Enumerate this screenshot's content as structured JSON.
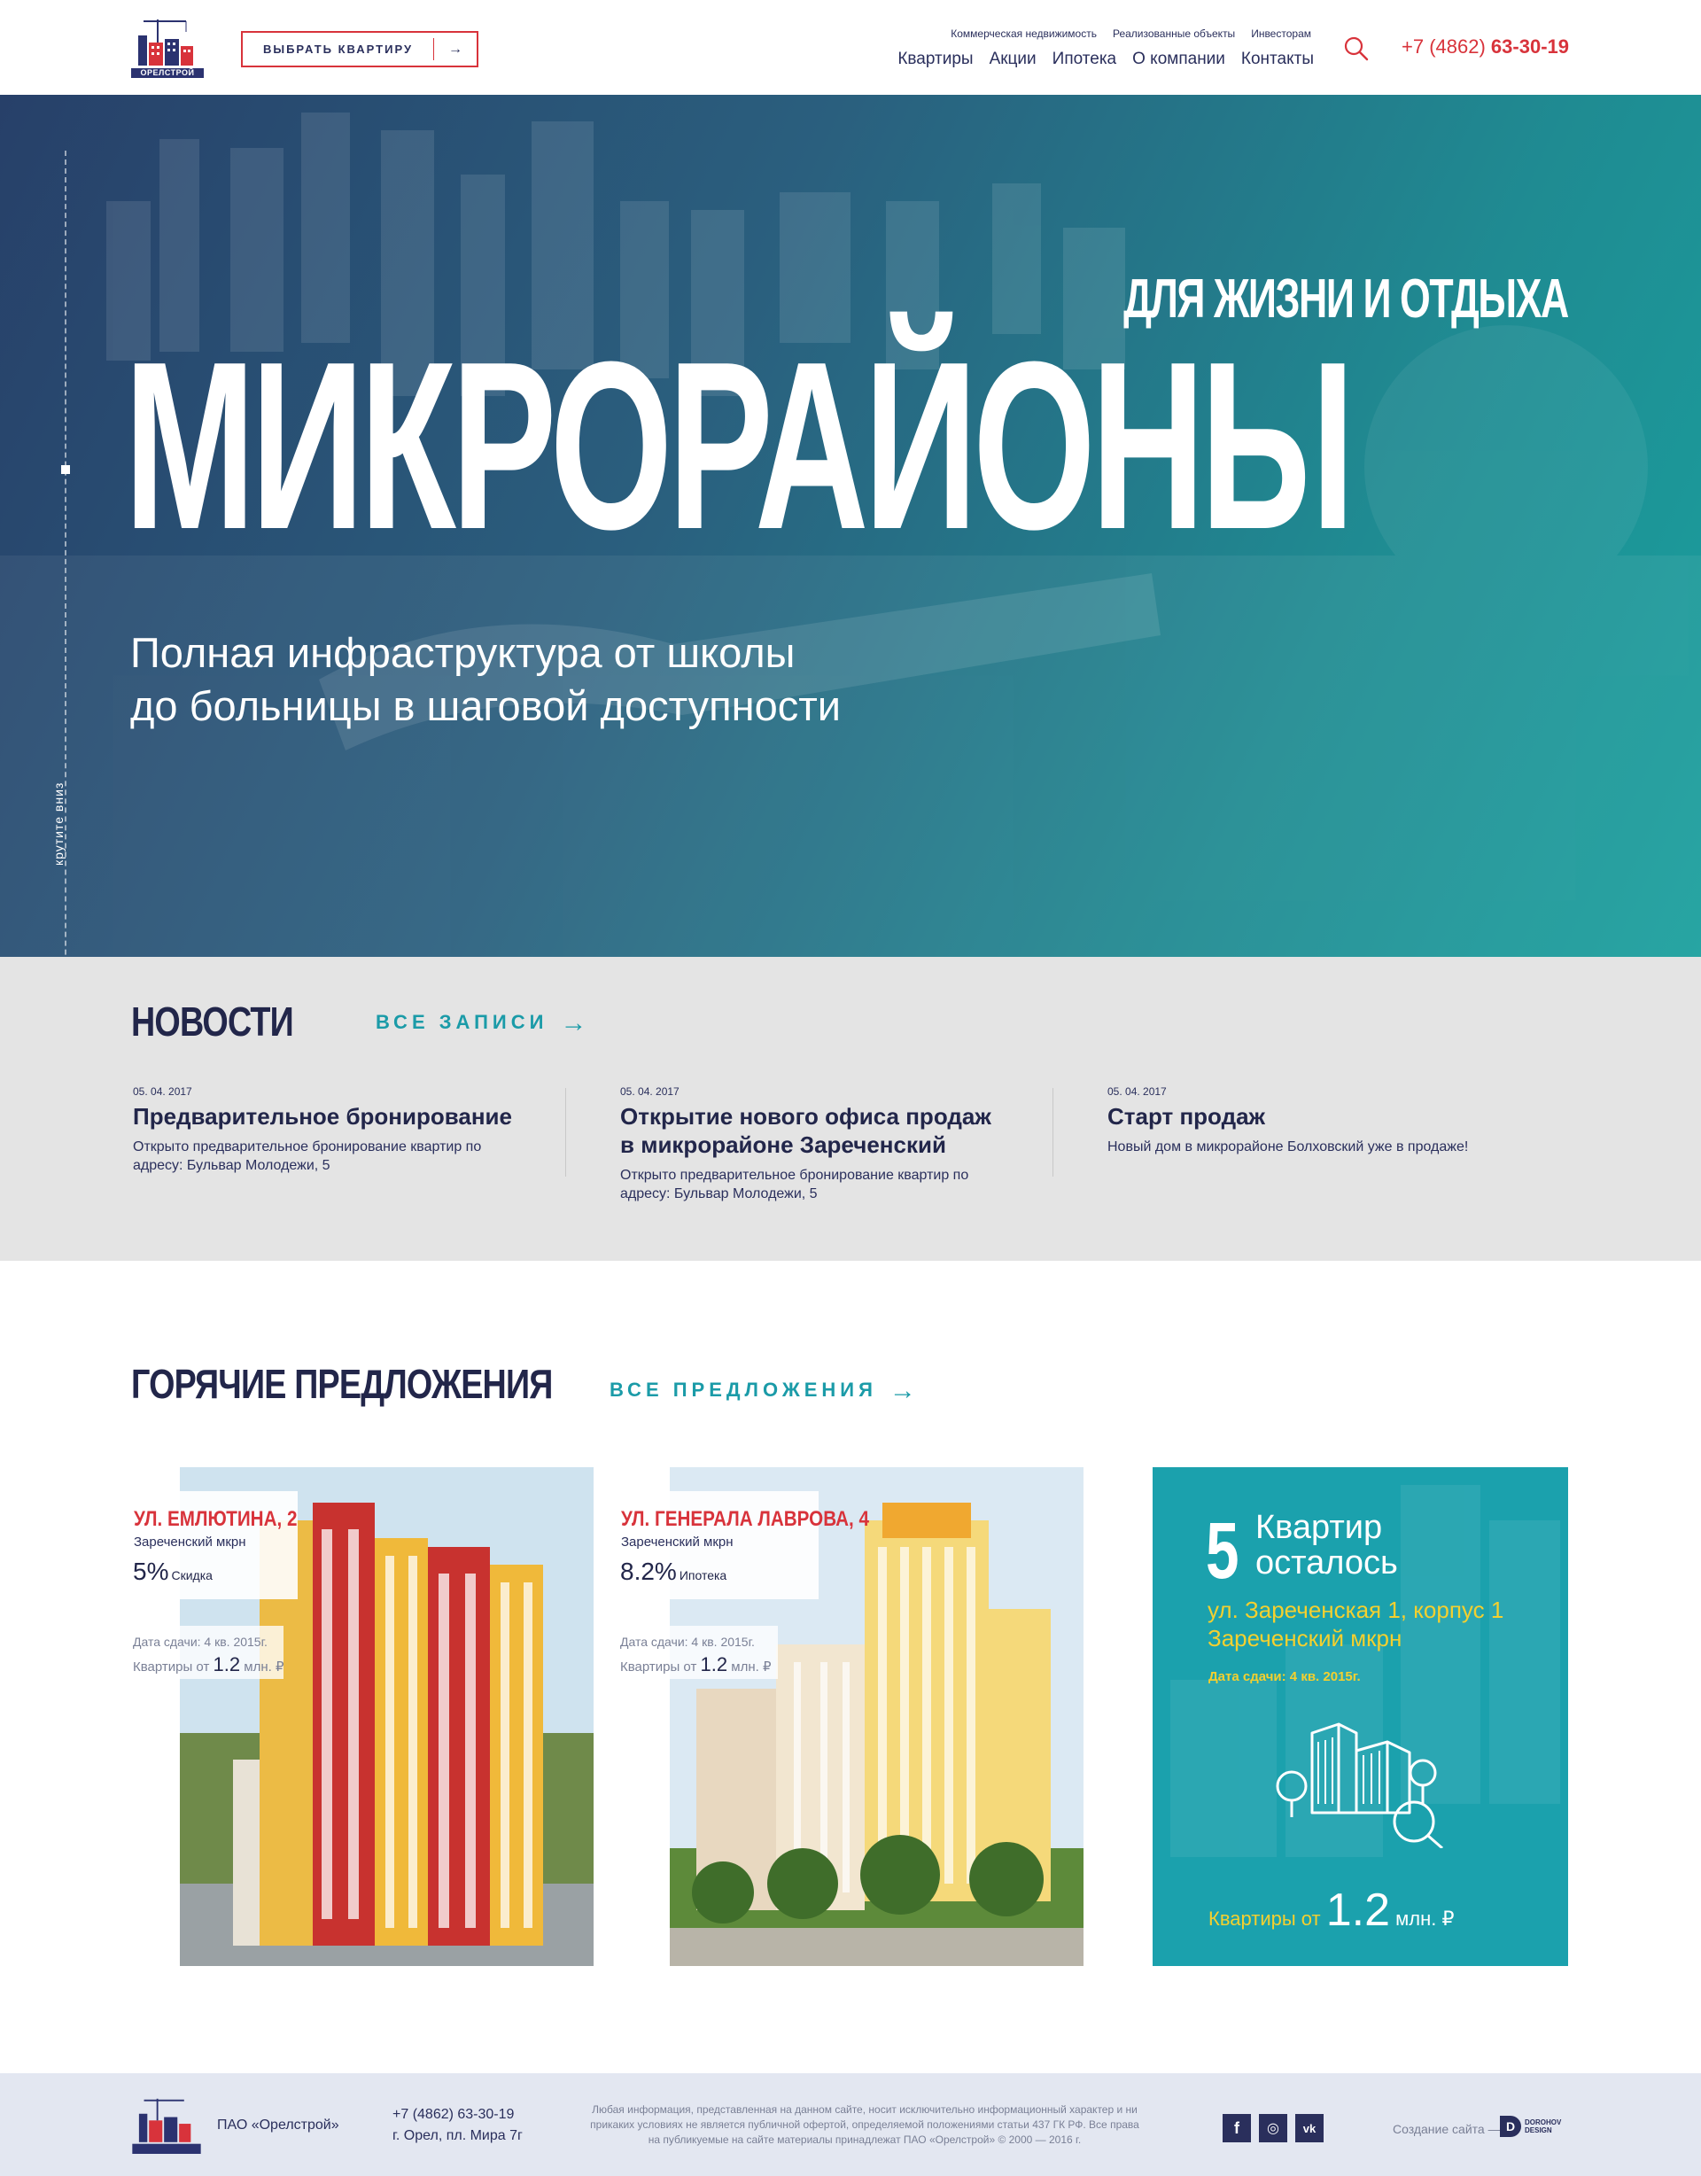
{
  "header": {
    "logo_text": "ОРЕЛСТРОЙ",
    "choose_button": "ВЫБРАТЬ КВАРТИРУ",
    "top_links": [
      "Коммерческая недвижимость",
      "Реализованные объекты",
      "Инвесторам"
    ],
    "main_links": [
      "Квартиры",
      "Акции",
      "Ипотека",
      "О компании",
      "Контакты"
    ],
    "phone_prefix": "+7 (4862)",
    "phone_number": "63-30-19"
  },
  "hero": {
    "tagline": "ДЛЯ ЖИЗНИ И ОТДЫХА",
    "title": "МИКРОРАЙОНЫ",
    "subtitle_line1": "Полная инфраструктура от школы",
    "subtitle_line2": "до больницы в шаговой доступности",
    "scroll_hint": "крутите вниз"
  },
  "news": {
    "title": "НОВОСТИ",
    "all_link": "ВСЕ ЗАПИСИ",
    "items": [
      {
        "date": "05. 04. 2017",
        "headline": "Предварительное бронирование",
        "text": "Открыто предварительное бронирование квартир по адресу: Бульвар Молодежи, 5"
      },
      {
        "date": "05. 04. 2017",
        "headline": "Открытие нового офиса продаж в микрорайоне Зареченский",
        "text": "Открыто предварительное бронирование квартир по адресу: Бульвар Молодежи, 5"
      },
      {
        "date": "05. 04. 2017",
        "headline": "Старт продаж",
        "text": "Новый дом в микрорайоне Болховский уже в продаже!"
      }
    ]
  },
  "offers": {
    "title": "ГОРЯЧИЕ ПРЕДЛОЖЕНИЯ",
    "all_link": "ВСЕ ПРЕДЛОЖЕНИЯ",
    "cards": [
      {
        "street": "УЛ. ЕМЛЮТИНА, 2",
        "district": "Зареченский мкрн",
        "percent": "5%",
        "percent_label": "Скидка",
        "date": "Дата сдачи: 4 кв. 2015г.",
        "price_prefix": "Квартиры от",
        "price_value": "1.2",
        "price_suffix": "млн. ₽"
      },
      {
        "street": "УЛ. ГЕНЕРАЛА ЛАВРОВА, 4",
        "district": "Зареченский мкрн",
        "percent": "8.2%",
        "percent_label": "Ипотека",
        "date": "Дата сдачи: 4 кв. 2015г.",
        "price_prefix": "Квартиры от",
        "price_value": "1.2",
        "price_suffix": "млн. ₽"
      }
    ],
    "promo": {
      "count": "5",
      "label_line1": "Квартир",
      "label_line2": "осталось",
      "street": "ул. Зареченская 1, корпус 1",
      "district": "Зареченский мкрн",
      "date": "Дата сдачи: 4 кв. 2015г.",
      "price_prefix": "Квартиры от",
      "price_value": "1.2",
      "price_unit": "млн.",
      "price_currency": "₽"
    }
  },
  "footer": {
    "company": "ПАО «Орелстрой»",
    "phone": "+7 (4862) 63-30-19",
    "address": "г. Орел, пл. Мира 7г",
    "legal": "Любая информация, представленная на данном сайте, носит исключительно информационный характер и ни прикаких условиях не является публичной офертой, определяемой положениями статьи 437 ГК РФ. Все права на публикуемые на сайте материалы принадлежат ПАО «Орелстрой» © 2000 — 2016 г.",
    "social": [
      "f",
      "◎",
      "vk"
    ],
    "credit": "Создание сайта —",
    "studio_line1": "DOROHOV",
    "studio_line2": "DESIGN"
  },
  "colors": {
    "accent_red": "#d8333b",
    "navy": "#22264a",
    "teal": "#1ba1ad",
    "yellow": "#f4d02f",
    "news_bg": "#e4e4e4",
    "footer_bg": "#e3e7f1"
  }
}
